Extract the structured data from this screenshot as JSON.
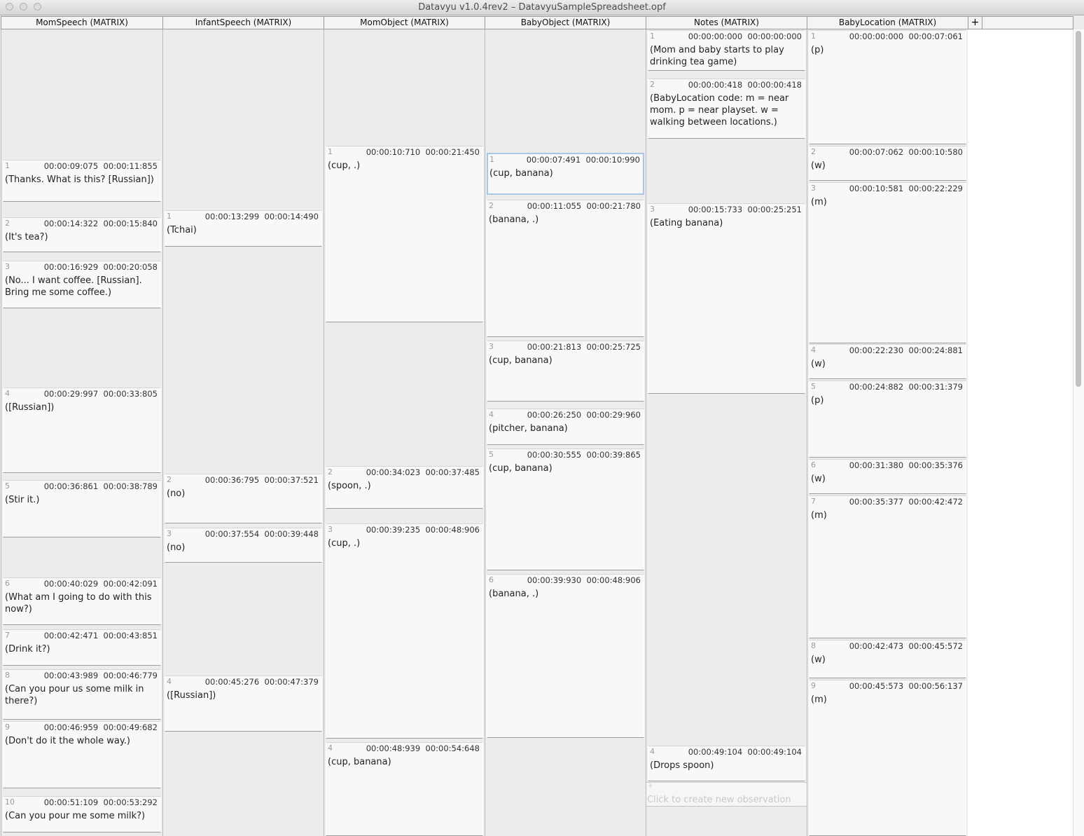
{
  "window": {
    "title": "Datavyu v1.0.4rev2 – DatavyuSampleSpreadsheet.opf"
  },
  "add_column_label": "+",
  "new_observation_label": "Click to create new observation",
  "new_observation_plus": "+",
  "columns": [
    {
      "name": "MomSpeech  (MATRIX)",
      "cells": [
        {
          "ord": "1",
          "onset": "00:00:09:075",
          "offset": "00:00:11:855",
          "value": "(Thanks. What is this? [Russian])"
        },
        {
          "ord": "2",
          "onset": "00:00:14:322",
          "offset": "00:00:15:840",
          "value": "(It's tea?)"
        },
        {
          "ord": "3",
          "onset": "00:00:16:929",
          "offset": "00:00:20:058",
          "value": "(No... I want coffee. [Russian]. Bring me some coffee.)"
        },
        {
          "ord": "4",
          "onset": "00:00:29:997",
          "offset": "00:00:33:805",
          "value": "([Russian])"
        },
        {
          "ord": "5",
          "onset": "00:00:36:861",
          "offset": "00:00:38:789",
          "value": "(Stir it.)"
        },
        {
          "ord": "6",
          "onset": "00:00:40:029",
          "offset": "00:00:42:091",
          "value": "(What am I going to do with this now?)"
        },
        {
          "ord": "7",
          "onset": "00:00:42:471",
          "offset": "00:00:43:851",
          "value": "(Drink it?)"
        },
        {
          "ord": "8",
          "onset": "00:00:43:989",
          "offset": "00:00:46:779",
          "value": "(Can you pour us some milk in there?)"
        },
        {
          "ord": "9",
          "onset": "00:00:46:959",
          "offset": "00:00:49:682",
          "value": "(Don't do it the whole way.)"
        },
        {
          "ord": "10",
          "onset": "00:00:51:109",
          "offset": "00:00:53:292",
          "value": "(Can you pour me some milk?)"
        }
      ]
    },
    {
      "name": "InfantSpeech  (MATRIX)",
      "cells": [
        {
          "ord": "1",
          "onset": "00:00:13:299",
          "offset": "00:00:14:490",
          "value": "(Tchai)"
        },
        {
          "ord": "2",
          "onset": "00:00:36:795",
          "offset": "00:00:37:521",
          "value": "(no)"
        },
        {
          "ord": "3",
          "onset": "00:00:37:554",
          "offset": "00:00:39:448",
          "value": "(no)"
        },
        {
          "ord": "4",
          "onset": "00:00:45:276",
          "offset": "00:00:47:379",
          "value": "([Russian])"
        }
      ]
    },
    {
      "name": "MomObject  (MATRIX)",
      "cells": [
        {
          "ord": "1",
          "onset": "00:00:10:710",
          "offset": "00:00:21:450",
          "value": "(cup, .)"
        },
        {
          "ord": "2",
          "onset": "00:00:34:023",
          "offset": "00:00:37:485",
          "value": "(spoon, .)"
        },
        {
          "ord": "3",
          "onset": "00:00:39:235",
          "offset": "00:00:48:906",
          "value": "(cup, .)"
        },
        {
          "ord": "4",
          "onset": "00:00:48:939",
          "offset": "00:00:54:648",
          "value": "(cup, banana)"
        }
      ]
    },
    {
      "name": "BabyObject  (MATRIX)",
      "cells": [
        {
          "ord": "1",
          "onset": "00:00:07:491",
          "offset": "00:00:10:990",
          "value": "(cup, banana)",
          "selected": true
        },
        {
          "ord": "2",
          "onset": "00:00:11:055",
          "offset": "00:00:21:780",
          "value": "(banana, .)"
        },
        {
          "ord": "3",
          "onset": "00:00:21:813",
          "offset": "00:00:25:725",
          "value": "(cup, banana)"
        },
        {
          "ord": "4",
          "onset": "00:00:26:250",
          "offset": "00:00:29:960",
          "value": "(pitcher, banana)"
        },
        {
          "ord": "5",
          "onset": "00:00:30:555",
          "offset": "00:00:39:865",
          "value": "(cup, banana)"
        },
        {
          "ord": "6",
          "onset": "00:00:39:930",
          "offset": "00:00:48:906",
          "value": "(banana, .)"
        }
      ]
    },
    {
      "name": "Notes  (MATRIX)",
      "cells": [
        {
          "ord": "1",
          "onset": "00:00:00:000",
          "offset": "00:00:00:000",
          "value": "(Mom and baby starts to play drinking tea game)"
        },
        {
          "ord": "2",
          "onset": "00:00:00:418",
          "offset": "00:00:00:418",
          "value": "(BabyLocation code: m = near mom. p = near playset. w = walking between locations.)"
        },
        {
          "ord": "3",
          "onset": "00:00:15:733",
          "offset": "00:00:25:251",
          "value": "(Eating banana)"
        },
        {
          "ord": "4",
          "onset": "00:00:49:104",
          "offset": "00:00:49:104",
          "value": "(Drops spoon)"
        }
      ]
    },
    {
      "name": "BabyLocation  (MATRIX)",
      "cells": [
        {
          "ord": "1",
          "onset": "00:00:00:000",
          "offset": "00:00:07:061",
          "value": "(p)"
        },
        {
          "ord": "2",
          "onset": "00:00:07:062",
          "offset": "00:00:10:580",
          "value": "(w)"
        },
        {
          "ord": "3",
          "onset": "00:00:10:581",
          "offset": "00:00:22:229",
          "value": "(m)"
        },
        {
          "ord": "4",
          "onset": "00:00:22:230",
          "offset": "00:00:24:881",
          "value": "(w)"
        },
        {
          "ord": "5",
          "onset": "00:00:24:882",
          "offset": "00:00:31:379",
          "value": "(p)"
        },
        {
          "ord": "6",
          "onset": "00:00:31:380",
          "offset": "00:00:35:376",
          "value": "(w)"
        },
        {
          "ord": "7",
          "onset": "00:00:35:377",
          "offset": "00:00:42:472",
          "value": "(m)"
        },
        {
          "ord": "8",
          "onset": "00:00:42:473",
          "offset": "00:00:45:572",
          "value": "(w)"
        },
        {
          "ord": "9",
          "onset": "00:00:45:573",
          "offset": "00:00:56:137",
          "value": "(m)"
        }
      ]
    }
  ]
}
